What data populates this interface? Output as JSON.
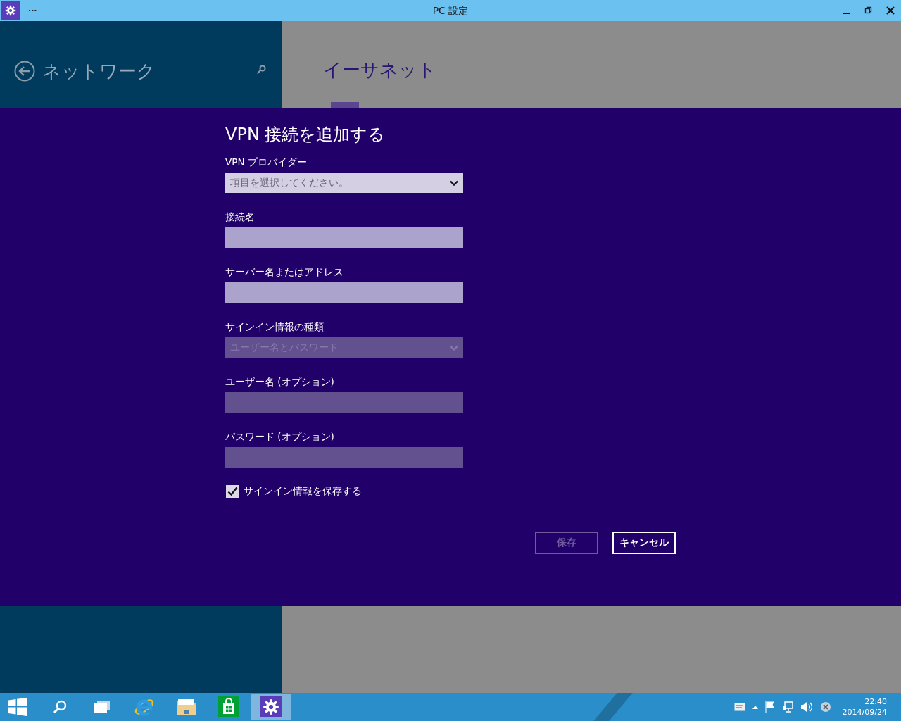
{
  "window": {
    "title": "PC 設定",
    "menu": "···"
  },
  "sidebar": {
    "title": "ネットワーク"
  },
  "content": {
    "title": "イーサネット"
  },
  "dialog": {
    "title": "VPN 接続を追加する",
    "fields": [
      {
        "kind": "select",
        "label": "VPN プロバイダー",
        "placeholder": "項目を選択してください。",
        "disabled": false
      },
      {
        "kind": "text",
        "label": "接続名",
        "disabled": false
      },
      {
        "kind": "text",
        "label": "サーバー名またはアドレス",
        "disabled": false
      },
      {
        "kind": "select",
        "label": "サインイン情報の種類",
        "value": "ユーザー名とパスワード",
        "disabled": true
      },
      {
        "kind": "text",
        "label": "ユーザー名 (オプション)",
        "disabled": true
      },
      {
        "kind": "text",
        "label": "パスワード (オプション)",
        "disabled": true
      }
    ],
    "checkbox": {
      "label": "サインイン情報を保存する",
      "checked": true
    },
    "buttons": [
      {
        "label": "保存",
        "disabled": true
      },
      {
        "label": "キャンセル",
        "disabled": false
      }
    ]
  },
  "taskbar": {
    "apps": [
      {
        "kind": "start",
        "selected": false
      },
      {
        "kind": "search",
        "selected": false
      },
      {
        "kind": "taskview",
        "selected": false
      },
      {
        "kind": "browser",
        "selected": false
      },
      {
        "kind": "folder",
        "selected": false
      },
      {
        "kind": "store",
        "selected": false
      },
      {
        "kind": "settings",
        "selected": true
      }
    ],
    "tray": {
      "time": "22:40",
      "date": "2014/09/24"
    }
  }
}
